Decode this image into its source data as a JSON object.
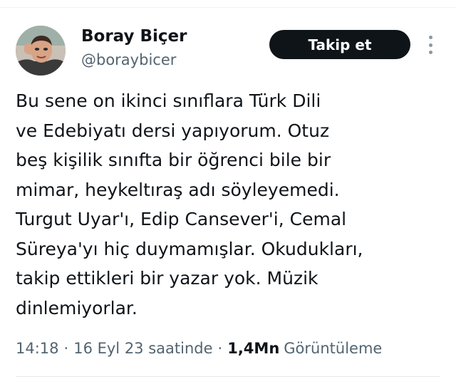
{
  "author": {
    "display_name": "Boray Biçer",
    "handle": "@boraybicer",
    "avatar_icon": "profile-photo"
  },
  "actions": {
    "follow_label": "Takip et",
    "more_icon": "vertical-ellipsis-icon"
  },
  "tweet": {
    "lines": [
      "Bu sene on ikinci sınıflara Türk Dili",
      "ve Edebiyatı dersi yapıyorum. Otuz",
      "beş kişilik sınıfta bir öğrenci bile bir",
      "mimar, heykeltıraş adı söyleyemedi.",
      "Turgut Uyar'ı, Edip Cansever'i, Cemal",
      "Süreya'yı hiç duymamışlar. Okudukları,",
      "takip ettikleri bir yazar yok. Müzik",
      "dinlemiyorlar."
    ]
  },
  "meta": {
    "time": "14:18",
    "separator": "·",
    "date": "16 Eyl 23 saatinde",
    "views_count": "1,4Mn",
    "views_label": "Görüntüleme"
  },
  "colors": {
    "text_primary": "#0f1419",
    "text_secondary": "#536471",
    "button_bg": "#0f1419",
    "button_text": "#ffffff",
    "divider": "#eff3f4"
  }
}
